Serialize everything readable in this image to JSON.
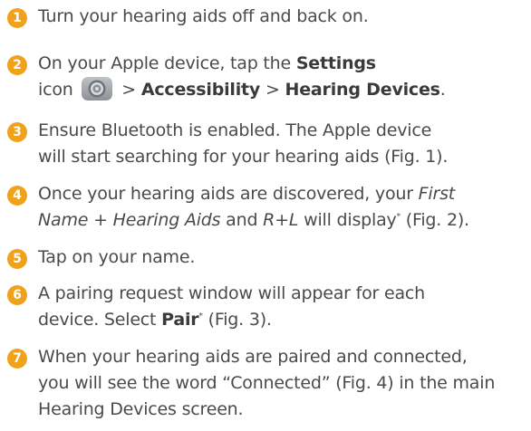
{
  "steps": [
    {
      "num": "1",
      "text": "Turn your hearing aids off and back on."
    },
    {
      "num": "2",
      "a": "On your Apple device, tap the ",
      "settings": "Settings",
      "icon_prefix": "icon",
      "sep1": ">",
      "accessibility": "Accessibility",
      "sep2": ">",
      "hearing_devices": "Hearing Devices",
      "end": "."
    },
    {
      "num": "3",
      "l1": "Ensure Bluetooth is enabled. The Apple device",
      "l2": "will start searching for your hearing aids (Fig. 1)."
    },
    {
      "num": "4",
      "a": "Once your hearing aids are discovered, your ",
      "b": "First",
      "c": "Name + Hearing Aids",
      "d": " and ",
      "e": "R+L",
      "f": " will display",
      "star": "*",
      "g": " (Fig. 2)."
    },
    {
      "num": "5",
      "text": "Tap on your name."
    },
    {
      "num": "6",
      "l1": "A pairing request window will appear for each",
      "a": "device. Select ",
      "pair": "Pair",
      "star": "*",
      "b": " (Fig. 3)."
    },
    {
      "num": "7",
      "l1": "When your hearing aids are paired and connected,",
      "l2": "you will see the word “Connected” (Fig. 4) in the main",
      "l3": "Hearing Devices screen."
    }
  ],
  "icons": {
    "settings_icon": "gear-icon"
  },
  "colors": {
    "badge": "#f0a21c",
    "text": "#4a4a4a"
  }
}
